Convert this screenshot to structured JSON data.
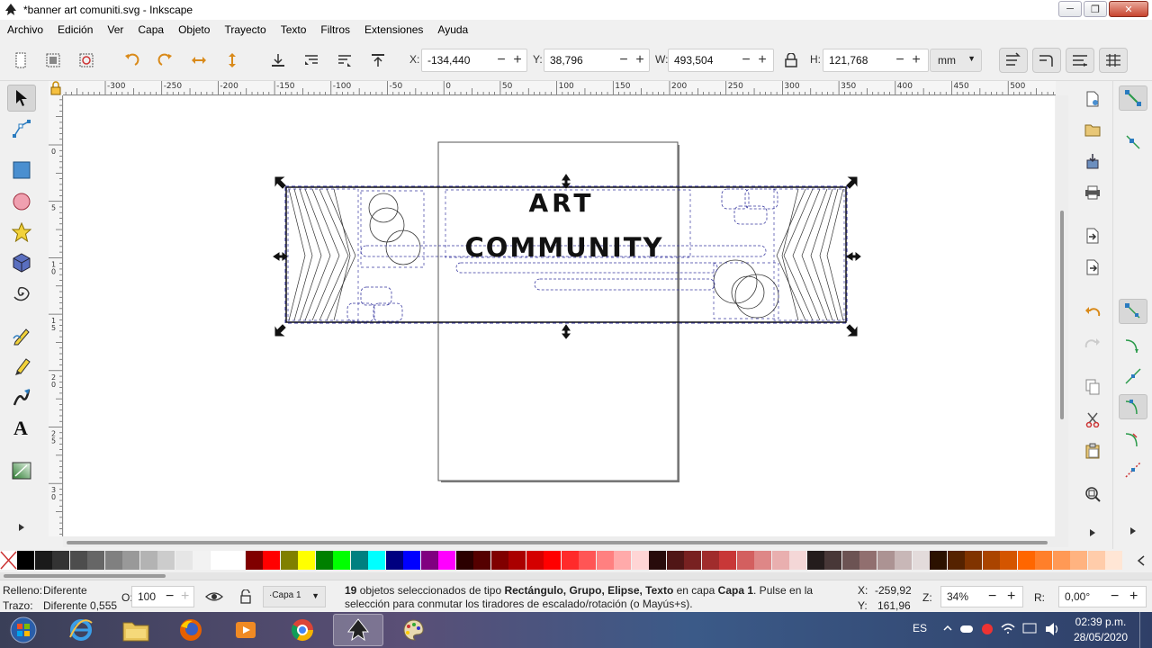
{
  "window": {
    "title": "*banner art comuniti.svg - Inkscape",
    "minimize": "─",
    "maximize": "❐",
    "close": "✕"
  },
  "menu": [
    "Archivo",
    "Edición",
    "Ver",
    "Capa",
    "Objeto",
    "Trayecto",
    "Texto",
    "Filtros",
    "Extensiones",
    "Ayuda"
  ],
  "toolcontrols": {
    "x_label": "X:",
    "x_value": "-134,440",
    "y_label": "Y:",
    "y_value": "38,796",
    "w_label": "W:",
    "w_value": "493,504",
    "h_label": "H:",
    "h_value": "121,768",
    "minus": "−",
    "plus": "+",
    "unit": "mm"
  },
  "ruler": {
    "h_labels": [
      "-300",
      "-250",
      "-200",
      "-150",
      "-100",
      "-50",
      "0",
      "50",
      "100",
      "150",
      "200",
      "250",
      "300",
      "350",
      "400",
      "450",
      "500"
    ],
    "v_labels": [
      "0",
      "5",
      "1 0",
      "1 5",
      "2 0",
      "2 5",
      "3 0"
    ]
  },
  "artwork": {
    "line1": "ART",
    "line2": "COMMUNITY"
  },
  "palette": [
    "#000000",
    "#1a1a1a",
    "#333333",
    "#4d4d4d",
    "#666666",
    "#808080",
    "#999999",
    "#b3b3b3",
    "#cccccc",
    "#e6e6e6",
    "#f2f2f2",
    "#ffffff",
    "#ffffff",
    "#800000",
    "#ff0000",
    "#808000",
    "#ffff00",
    "#008000",
    "#00ff00",
    "#008080",
    "#00ffff",
    "#000080",
    "#0000ff",
    "#800080",
    "#ff00ff",
    "#2b0000",
    "#550000",
    "#800000",
    "#aa0000",
    "#d40000",
    "#ff0000",
    "#ff2a2a",
    "#ff5555",
    "#ff8080",
    "#ffaaaa",
    "#ffd5d5",
    "#280b0b",
    "#501616",
    "#782121",
    "#a02c2c",
    "#c83737",
    "#d35f5f",
    "#de8787",
    "#e9afaf",
    "#f4d7d7",
    "#241c1c",
    "#483737",
    "#6c5353",
    "#916f6f",
    "#ac9393",
    "#c8b7b7",
    "#e3dbdb",
    "#2b1100",
    "#552200",
    "#803300",
    "#aa4400",
    "#d45500",
    "#ff6600",
    "#ff7f2a",
    "#ff9955",
    "#ffb380",
    "#ffccaa",
    "#ffe6d5"
  ],
  "status": {
    "fill_label": "Relleno:",
    "fill_value": "Diferente",
    "stroke_label": "Trazo:",
    "stroke_value": "Diferente 0,555",
    "opacity_label": "O:",
    "opacity_value": "100",
    "layer": "·Capa 1",
    "msg_count": "19",
    "msg_1": " objetos seleccionados de tipo ",
    "msg_types": "Rectángulo, Grupo, Elipse, Texto",
    "msg_2": " en capa ",
    "msg_layer": "Capa 1",
    "msg_3": ". Pulse en la",
    "msg_line2": "selección para conmutar los tiradores de escalado/rotación (o Mayús+s).",
    "x_label": "X:",
    "x_value": "-259,92",
    "y_label": "Y:",
    "y_value": "161,96",
    "z_label": "Z:",
    "zoom": "34%",
    "r_label": "R:",
    "rotation": "0,00°"
  },
  "taskbar": {
    "lang": "ES",
    "time": "02:39 p.m.",
    "date": "28/05/2020"
  }
}
